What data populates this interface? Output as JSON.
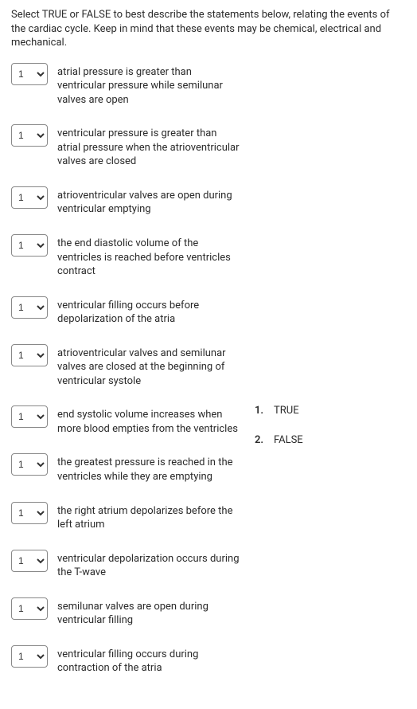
{
  "instructions": "Select TRUE or FALSE to best describe the statements below, relating the events of the cardiac cycle. Keep in mind that these events may be chemical, electrical and mechanical.",
  "select_value": "1",
  "statements": [
    "atrial pressure is greater than ventricular pressure while semilunar valves are open",
    "ventricular pressure is greater than atrial pressure when the atrioventricular valves are closed",
    "atrioventricular valves are open during ventricular emptying",
    "the end diastolic volume of the ventricles is reached before ventricles contract",
    "ventricular filling occurs before depolarization of the atria",
    "atrioventricular valves and semilunar valves are closed at the beginning of ventricular systole",
    "end systolic volume increases when more blood empties from the ventricles",
    "the greatest pressure is reached in the ventricles while they are emptying",
    "the right atrium depolarizes before the left atrium",
    "ventricular depolarization occurs during the T-wave",
    "semilunar valves are open during ventricular filling",
    "ventricular filling occurs during contraction of the atria"
  ],
  "options": [
    {
      "num": "1.",
      "label": "TRUE"
    },
    {
      "num": "2.",
      "label": "FALSE"
    }
  ]
}
